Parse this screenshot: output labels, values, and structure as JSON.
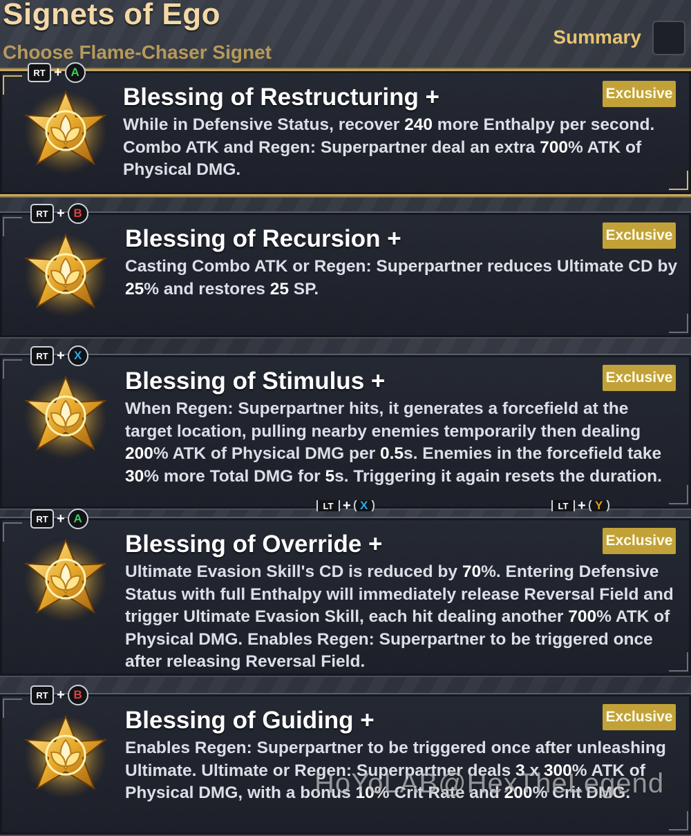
{
  "header": {
    "title": "Signets of Ego",
    "subtitle": "Choose Flame-Chaser Signet",
    "summary_label": "Summary"
  },
  "colors": {
    "gold": "#c2a238",
    "accent_a": "#3fcf5a",
    "accent_b": "#e0413d",
    "accent_x": "#2aa8e8",
    "accent_y": "#e3a21a"
  },
  "cards": [
    {
      "title": "Blessing of Restructuring +",
      "badge": "Exclusive",
      "combo": {
        "trigger": "RT",
        "plus": "+",
        "button": "A"
      },
      "desc_parts": [
        "While in Defensive Status, recover ",
        "240",
        " more Enthalpy per second. Combo ATK and Regen: Superpartner deal an extra ",
        "700",
        "% ATK of Physical DMG."
      ]
    },
    {
      "title": "Blessing of Recursion +",
      "badge": "Exclusive",
      "combo": {
        "trigger": "RT",
        "plus": "+",
        "button": "B"
      },
      "desc_parts": [
        "Casting Combo ATK or Regen: Superpartner reduces Ultimate CD by ",
        "25",
        "% and restores ",
        "25",
        " SP."
      ]
    },
    {
      "title": "Blessing of Stimulus +",
      "badge": "Exclusive",
      "combo": {
        "trigger": "RT",
        "plus": "+",
        "button": "X"
      },
      "desc_parts": [
        "When Regen: Superpartner hits, it generates a forcefield at the target location, pulling nearby enemies temporarily then dealing ",
        "200",
        "% ATK of Physical DMG per ",
        "0.5",
        "s. Enemies in the forcefield take ",
        "30",
        "% more Total DMG for ",
        "5",
        "s. Triggering it again resets the duration."
      ]
    },
    {
      "title": "Blessing of Override +",
      "badge": "Exclusive",
      "combo": {
        "trigger": "RT",
        "plus": "+",
        "button": "A"
      },
      "desc_parts": [
        "Ultimate Evasion Skill's CD is reduced by ",
        "70",
        "%. Entering Defensive Status with full Enthalpy will immediately release Reversal Field and trigger Ultimate Evasion Skill, each hit dealing another ",
        "700",
        "% ATK of Physical DMG. Enables Regen: Superpartner to be triggered once after releasing Reversal Field."
      ]
    },
    {
      "title": "Blessing of Guiding +",
      "badge": "Exclusive",
      "combo": {
        "trigger": "RT",
        "plus": "+",
        "button": "B"
      },
      "desc_parts": [
        "Enables Regen: Superpartner to be triggered once after unleashing Ultimate. Ultimate or Regen: Superpartner deals ",
        "3",
        " x ",
        "300",
        "% ATK of Physical DMG, with a bonus ",
        "10",
        "% Crit Rate and ",
        "200",
        "% Crit DMG."
      ]
    }
  ],
  "hidden_combos": [
    {
      "trigger": "LT",
      "plus": "+",
      "button": "X"
    },
    {
      "trigger": "LT",
      "plus": "+",
      "button": "Y"
    }
  ],
  "watermark": "HoYoLAB@HexTheLegend"
}
